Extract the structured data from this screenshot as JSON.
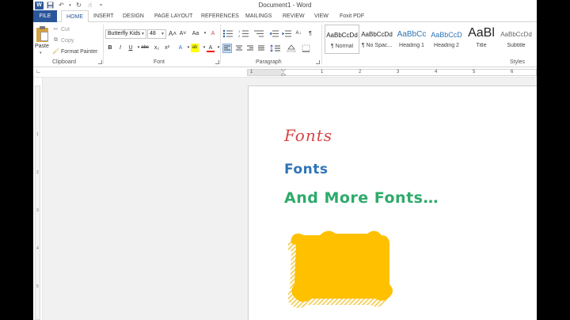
{
  "window": {
    "title": "Document1 - Word"
  },
  "tabs": [
    {
      "label": "FILE"
    },
    {
      "label": "HOME"
    },
    {
      "label": "INSERT"
    },
    {
      "label": "DESIGN"
    },
    {
      "label": "PAGE LAYOUT"
    },
    {
      "label": "REFERENCES"
    },
    {
      "label": "MAILINGS"
    },
    {
      "label": "REVIEW"
    },
    {
      "label": "VIEW"
    },
    {
      "label": "Foxit PDF"
    }
  ],
  "clipboard": {
    "paste": "Paste",
    "cut": "Cut",
    "copy": "Copy",
    "format_painter": "Format Painter",
    "label": "Clipboard"
  },
  "font": {
    "name": "Butterfly Kids",
    "size": "48",
    "label": "Font",
    "bold": "B",
    "italic": "I",
    "underline": "U",
    "strike": "abc",
    "subscript": "x₂",
    "superscript": "x²",
    "grow": "A˄",
    "shrink": "A˅",
    "case": "Aa",
    "clear": "A",
    "effects": "A",
    "highlight": "ab",
    "color": "A"
  },
  "paragraph": {
    "label": "Paragraph",
    "pilcrow": "¶"
  },
  "styles": {
    "label": "Styles",
    "items": [
      {
        "preview": "AaBbCcDd",
        "name": "¶ Normal"
      },
      {
        "preview": "AaBbCcDd",
        "name": "¶ No Spac..."
      },
      {
        "preview": "AaBbCc",
        "name": "Heading 1"
      },
      {
        "preview": "AaBbCcD",
        "name": "Heading 2"
      },
      {
        "preview": "AaBl",
        "name": "Title"
      },
      {
        "preview": "AaBbCcDd",
        "name": "Subtitle"
      }
    ]
  },
  "ruler": {
    "numbers": [
      "1",
      "1",
      "2",
      "3",
      "4",
      "5",
      "6"
    ]
  },
  "vruler": {
    "numbers": [
      "1",
      "2",
      "3",
      "4",
      "5"
    ]
  },
  "document": {
    "line1": "Fonts",
    "line2": "Fonts",
    "line3": "And More Fonts…"
  },
  "colors": {
    "line1": "#d64545",
    "line2": "#2e75b6",
    "line3": "#2eaa6b",
    "shape_fill": "#ffc000",
    "shape_shadow": "#f2d46a",
    "accent": "#2b579a"
  }
}
